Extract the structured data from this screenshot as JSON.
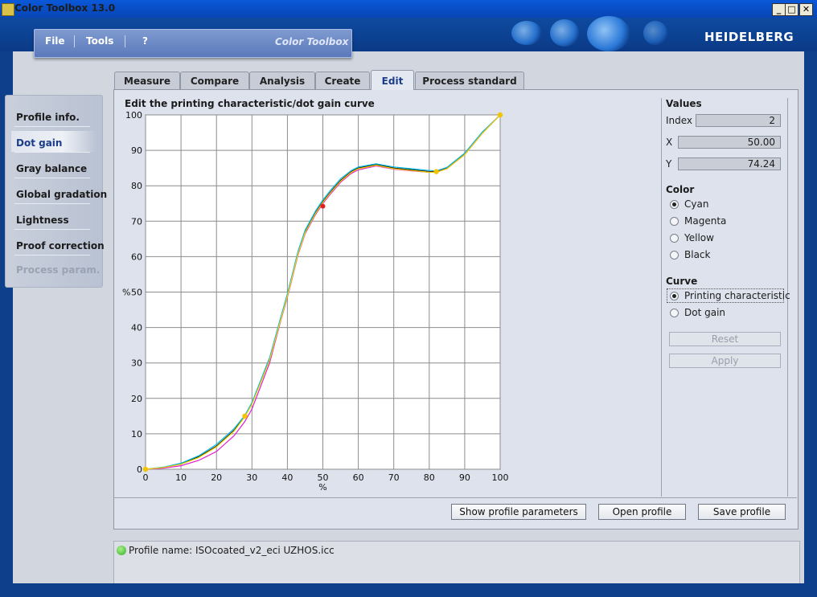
{
  "window": {
    "title": "Color Toolbox 13.0",
    "minimize": "_",
    "maximize": "□",
    "close": "✕"
  },
  "header": {
    "brand": "HEIDELBERG",
    "menu_brand": "Color Toolbox",
    "menu": [
      "File",
      "Tools",
      "?"
    ]
  },
  "sidebar": {
    "items": [
      "Profile info.",
      "Dot gain",
      "Gray balance",
      "Global gradation",
      "Lightness",
      "Proof correction",
      "Process param."
    ],
    "active": "Dot gain"
  },
  "tabs": {
    "items": [
      "Measure",
      "Compare",
      "Analysis",
      "Create",
      "Edit",
      "Process standard"
    ],
    "active": "Edit"
  },
  "chart_title": "Edit the printing characteristic/dot gain curve",
  "chart_data": {
    "type": "line",
    "title": "Edit the printing characteristic/dot gain curve",
    "xlabel": "%",
    "ylabel": "%",
    "xlim": [
      0,
      100
    ],
    "ylim": [
      0,
      100
    ],
    "xticks": [
      "0",
      "10",
      "20",
      "30",
      "40",
      "50",
      "60",
      "70",
      "80",
      "90",
      "100"
    ],
    "yticks": [
      "0",
      "10",
      "20",
      "30",
      "40",
      "50",
      "60",
      "70",
      "80",
      "90",
      "100"
    ],
    "grid": true,
    "series": [
      {
        "color": "#000000",
        "x": [
          0,
          5,
          10,
          15,
          20,
          25,
          28,
          30,
          35,
          38,
          40,
          43,
          45,
          48,
          50,
          52,
          55,
          58,
          60,
          65,
          70,
          75,
          80,
          82,
          85,
          90,
          95,
          100
        ],
        "values": [
          0,
          0.5,
          1.5,
          3.5,
          6.5,
          11,
          15,
          18.5,
          31,
          42,
          49,
          61,
          67,
          72.5,
          75.5,
          78,
          81.5,
          84,
          85,
          86,
          85,
          84.5,
          84,
          84,
          85,
          89,
          95,
          100
        ]
      },
      {
        "color": "#00b8e0",
        "x": [
          0,
          5,
          10,
          15,
          20,
          25,
          28,
          30,
          35,
          38,
          40,
          43,
          45,
          48,
          50,
          52,
          55,
          58,
          60,
          65,
          70,
          75,
          80,
          82,
          85,
          90,
          95,
          100
        ],
        "values": [
          0,
          0.6,
          1.7,
          3.8,
          7,
          11.5,
          15.2,
          18.8,
          31.5,
          42.5,
          49.5,
          61.5,
          67.5,
          73,
          76,
          78.5,
          82,
          84.3,
          85.3,
          86.2,
          85.3,
          84.8,
          84.3,
          84.2,
          85.2,
          89.2,
          95.2,
          100
        ]
      },
      {
        "color": "#e020d0",
        "x": [
          0,
          5,
          10,
          15,
          20,
          25,
          28,
          30,
          35,
          38,
          40,
          43,
          45,
          48,
          50,
          52,
          55,
          58,
          60,
          65,
          70,
          75,
          80,
          82,
          85,
          90,
          95,
          100
        ],
        "values": [
          0,
          0.3,
          1,
          2.5,
          5,
          9.5,
          13.5,
          17,
          30,
          41.5,
          48.5,
          60.5,
          66.5,
          72,
          75,
          77.5,
          81,
          83.5,
          84.5,
          85.6,
          84.7,
          84.2,
          83.8,
          83.8,
          84.8,
          88.8,
          94.8,
          100
        ]
      },
      {
        "color": "#f2d400",
        "x": [
          0,
          5,
          10,
          15,
          20,
          25,
          28,
          30,
          35,
          38,
          40,
          43,
          45,
          48,
          50,
          52,
          55,
          58,
          60,
          65,
          70,
          75,
          80,
          82,
          85,
          90,
          95,
          100
        ],
        "values": [
          0,
          0.5,
          1.4,
          3.3,
          6.3,
          10.8,
          14.8,
          18.3,
          30.8,
          41.8,
          48.8,
          60.8,
          66.8,
          72.3,
          75.3,
          77.8,
          81.3,
          83.8,
          84.8,
          85.8,
          84.8,
          84.3,
          83.8,
          83.8,
          84.8,
          88.8,
          94.8,
          100
        ]
      }
    ],
    "control_points": [
      {
        "x": 0,
        "y": 0
      },
      {
        "x": 28,
        "y": 15
      },
      {
        "x": 82,
        "y": 84
      },
      {
        "x": 100,
        "y": 100
      }
    ],
    "selected_point": {
      "x": 50,
      "y": 74.24
    },
    "point_color": "#f5c400",
    "selected_color": "#e02020"
  },
  "values": {
    "header": "Values",
    "index_label": "Index",
    "index": "2",
    "x_label": "X",
    "x": "50.00",
    "y_label": "Y",
    "y": "74.24"
  },
  "color": {
    "header": "Color",
    "options": [
      "Cyan",
      "Magenta",
      "Yellow",
      "Black"
    ],
    "selected": "Cyan"
  },
  "curve": {
    "header": "Curve",
    "options": [
      "Printing characteristic",
      "Dot gain"
    ],
    "selected": "Printing characteristic"
  },
  "buttons": {
    "reset": "Reset",
    "apply": "Apply",
    "show_params": "Show profile parameters",
    "open": "Open profile",
    "save": "Save profile"
  },
  "status": {
    "profile_name": "Profile name: ISOcoated_v2_eci UZHOS.icc"
  }
}
